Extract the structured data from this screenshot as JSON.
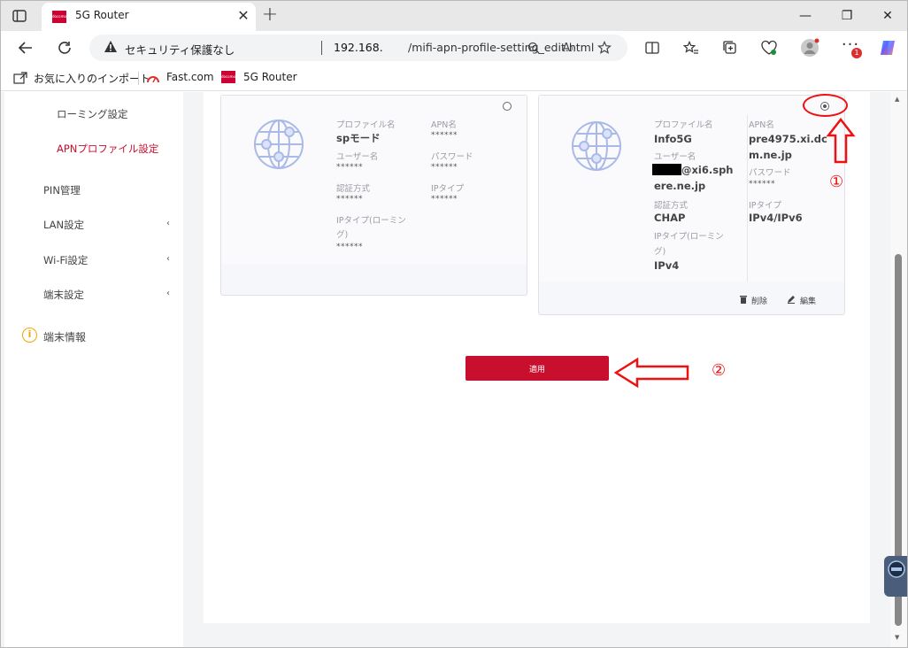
{
  "browser": {
    "tab_title": "5G Router",
    "favicon_text": "docomo",
    "new_tab": "+",
    "close_tab": "✕",
    "window_min": "—",
    "window_max": "❐",
    "window_close": "✕"
  },
  "address_bar": {
    "security_label": "セキュリティ保護なし",
    "host": "192.168.",
    "path": "/mifi-apn-profile-setting_edit.html",
    "notification_count": "1"
  },
  "bookmarks": [
    {
      "label": "お気に入りのインポート"
    },
    {
      "label": "Fast.com"
    },
    {
      "label": "5G Router"
    }
  ],
  "sidebar": {
    "items": [
      {
        "label": "ローミング設定"
      },
      {
        "label": "APNプロファイル設定"
      },
      {
        "label": "PIN管理"
      },
      {
        "label": "LAN設定"
      },
      {
        "label": "Wi-Fi設定"
      },
      {
        "label": "端末設定"
      },
      {
        "label": "端末情報"
      }
    ]
  },
  "profiles": [
    {
      "profile_name_label": "プロファイル名",
      "profile_name": "spモード",
      "apn_label": "APN名",
      "apn": "******",
      "user_label": "ユーザー名",
      "user": "******",
      "password_label": "パスワード",
      "password": "******",
      "auth_label": "認証方式",
      "auth": "******",
      "ip_type_label": "IPタイプ",
      "ip_type": "******",
      "ip_roaming_label_1": "IPタイプ(ローミン",
      "ip_roaming_label_2": "グ)",
      "ip_roaming": "******"
    },
    {
      "profile_name_label": "プロファイル名",
      "profile_name": "Info5G",
      "apn_label": "APN名",
      "apn_1": "pre4975.xi.dc",
      "apn_2": "m.ne.jp",
      "user_label": "ユーザー名",
      "user_1": "@xi6.sph",
      "user_2": "ere.ne.jp",
      "password_label": "パスワード",
      "password": "******",
      "auth_label": "認証方式",
      "auth": "CHAP",
      "ip_type_label": "IPタイプ",
      "ip_type": "IPv4/IPv6",
      "ip_roaming_label_1": "IPタイプ(ローミン",
      "ip_roaming_label_2": "グ)",
      "ip_roaming": "IPv4",
      "delete_label": "削除",
      "edit_label": "編集"
    }
  ],
  "apply_label": "適用",
  "annotations": {
    "marker_1": "①",
    "marker_2": "②"
  },
  "colors": {
    "brand_red": "#c8102e",
    "annotation_red": "#e11"
  }
}
